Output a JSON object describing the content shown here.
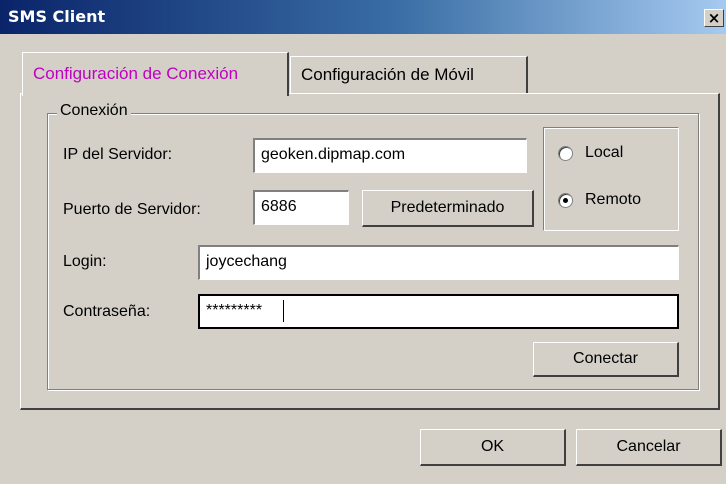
{
  "window": {
    "title": "SMS Client",
    "close_glyph": "×"
  },
  "tabs": [
    {
      "label": "Configuración de Conexión",
      "active": true
    },
    {
      "label": "Configuración de Móvil",
      "active": false
    }
  ],
  "group": {
    "legend": "Conexión"
  },
  "server_ip": {
    "label": "IP del Servidor:",
    "value": "geoken.dipmap.com"
  },
  "server_port": {
    "label": "Puerto de Servidor:",
    "value": "6886",
    "default_button": "Predeterminado"
  },
  "mode": {
    "options": [
      {
        "label": "Local",
        "selected": false
      },
      {
        "label": "Remoto",
        "selected": true
      }
    ]
  },
  "login": {
    "label": "Login:",
    "value": "joycechang"
  },
  "password": {
    "label": "Contraseña:",
    "value": "*********"
  },
  "connect_button": "Conectar",
  "footer": {
    "ok": "OK",
    "cancel": "Cancelar"
  },
  "colors": {
    "active_tab_text": "#c000c0",
    "title_bar_start": "#0a246a",
    "title_bar_end": "#a6caf0",
    "window_bg": "#d4d0c8"
  }
}
